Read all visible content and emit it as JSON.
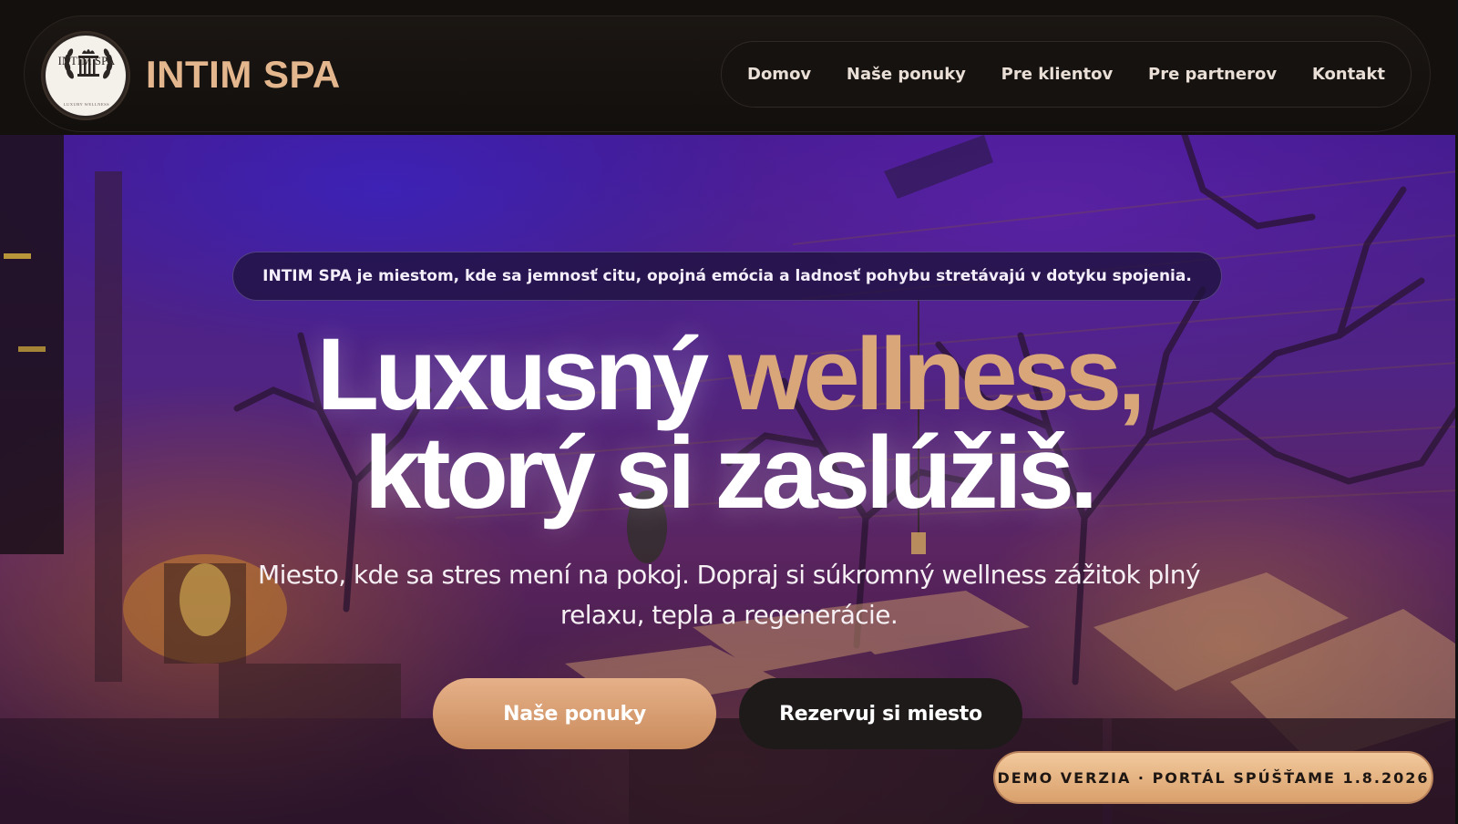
{
  "brand": {
    "name": "INTIM SPA",
    "logo_text": "INTIM SPA",
    "logo_subtext": "LUXURY WELLNESS",
    "accent_color": "#d9a67a"
  },
  "nav": {
    "items": [
      {
        "label": "Domov"
      },
      {
        "label": "Naše ponuky"
      },
      {
        "label": "Pre klientov"
      },
      {
        "label": "Pre partnerov"
      },
      {
        "label": "Kontakt"
      }
    ]
  },
  "hero": {
    "tagline": "INTIM SPA je miestom, kde sa jemnosť citu, opojná emócia a ladnosť pohybu stretávajú v dotyku spojenia.",
    "headline_part1": "Luxusný ",
    "headline_accent": "wellness,",
    "headline_part2": "ktorý si zaslúžiš.",
    "subtext": "Miesto, kde sa stres mení na pokoj. Dopraj si súkromný wellness zážitok plný relaxu, tepla a regenerácie.",
    "primary_button": "Naše ponuky",
    "secondary_button": "Rezervuj si miesto"
  },
  "demo_badge": "DEMO VERZIA · PORTÁL SPÚŠŤAME 1.8.2026"
}
